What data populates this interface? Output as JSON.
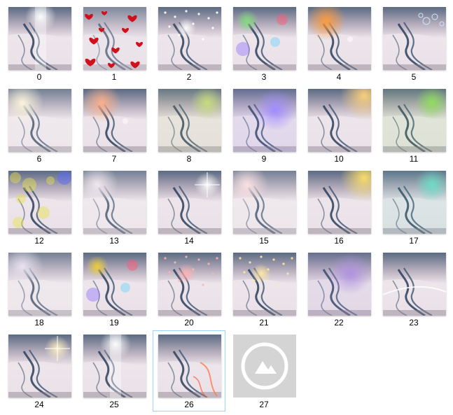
{
  "window": {
    "view": "large-icons",
    "selected_index": 26
  },
  "items": [
    {
      "label": "0",
      "overlay": "light-beam",
      "accent": "#ffffff"
    },
    {
      "label": "1",
      "overlay": "hearts",
      "accent": "#d0101a"
    },
    {
      "label": "2",
      "overlay": "sparkle-hearts",
      "accent": "#ffffff"
    },
    {
      "label": "3",
      "overlay": "rainbow-stars",
      "accent": "#7fe07a"
    },
    {
      "label": "4",
      "overlay": "lens-flare",
      "accent": "#ff9a3a"
    },
    {
      "label": "5",
      "overlay": "bubbles",
      "accent": "#cfe6ff"
    },
    {
      "label": "6",
      "overlay": "glow",
      "accent": "#fff6d8"
    },
    {
      "label": "7",
      "overlay": "lens-flare",
      "accent": "#ffb08a"
    },
    {
      "label": "8",
      "overlay": "rainbow-light",
      "accent": "#c8e07a"
    },
    {
      "label": "9",
      "overlay": "violet-light",
      "accent": "#9f8aff"
    },
    {
      "label": "10",
      "overlay": "warm-light",
      "accent": "#ffd27a"
    },
    {
      "label": "11",
      "overlay": "rainbow-light",
      "accent": "#8fe05a"
    },
    {
      "label": "12",
      "overlay": "bokeh",
      "accent": "#e6e04a"
    },
    {
      "label": "13",
      "overlay": "soft",
      "accent": "#f2e8ee"
    },
    {
      "label": "14",
      "overlay": "star-burst",
      "accent": "#ffffff"
    },
    {
      "label": "15",
      "overlay": "haze",
      "accent": "#ffe0e0"
    },
    {
      "label": "16",
      "overlay": "warm-light",
      "accent": "#ffe06a"
    },
    {
      "label": "17",
      "overlay": "prism",
      "accent": "#6ae0c8"
    },
    {
      "label": "18",
      "overlay": "soft",
      "accent": "#e8e0f0"
    },
    {
      "label": "19",
      "overlay": "bokeh-rainbow",
      "accent": "#f0d030"
    },
    {
      "label": "20",
      "overlay": "sparkles",
      "accent": "#ffb0b0"
    },
    {
      "label": "21",
      "overlay": "sparkles",
      "accent": "#ffe8a0"
    },
    {
      "label": "22",
      "overlay": "violet-light",
      "accent": "#b090e0"
    },
    {
      "label": "23",
      "overlay": "streak",
      "accent": "#ffffff"
    },
    {
      "label": "24",
      "overlay": "star-burst",
      "accent": "#fff2c0"
    },
    {
      "label": "25",
      "overlay": "light-beam",
      "accent": "#ffffff"
    },
    {
      "label": "26",
      "overlay": "ribbon",
      "accent": "#ff7a50"
    },
    {
      "label": "27",
      "overlay": "placeholder",
      "accent": "#d4d4d4"
    }
  ]
}
